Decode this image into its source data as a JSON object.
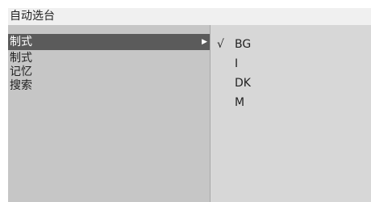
{
  "window": {
    "title": "自动选台"
  },
  "left_pane": {
    "active_item": {
      "label": "制式",
      "arrow": "▶"
    },
    "items": [
      {
        "label": "制式"
      },
      {
        "label": "记忆"
      },
      {
        "label": "搜索"
      }
    ]
  },
  "right_pane": {
    "options": [
      {
        "label": "BG",
        "check": "√"
      },
      {
        "label": "I",
        "check": ""
      },
      {
        "label": "DK",
        "check": ""
      },
      {
        "label": "M",
        "check": ""
      }
    ]
  },
  "colors": {
    "title_bg": "#f0f0f0",
    "left_bg": "#c6c6c6",
    "right_bg": "#d7d7d7",
    "selected_bg": "#5b5b5b"
  }
}
